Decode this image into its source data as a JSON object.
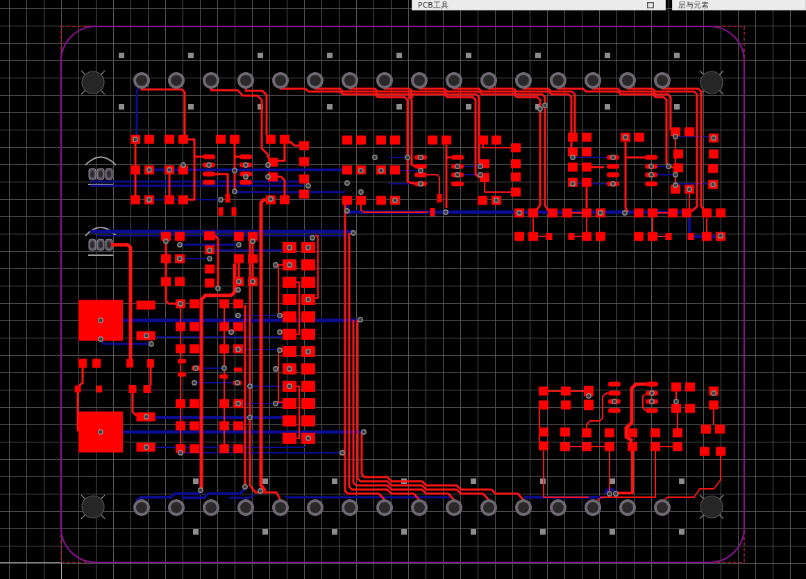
{
  "panels": [
    {
      "title": "PCB工具",
      "restore_button": true
    },
    {
      "title": "层与元素",
      "restore_button": false
    }
  ]
}
